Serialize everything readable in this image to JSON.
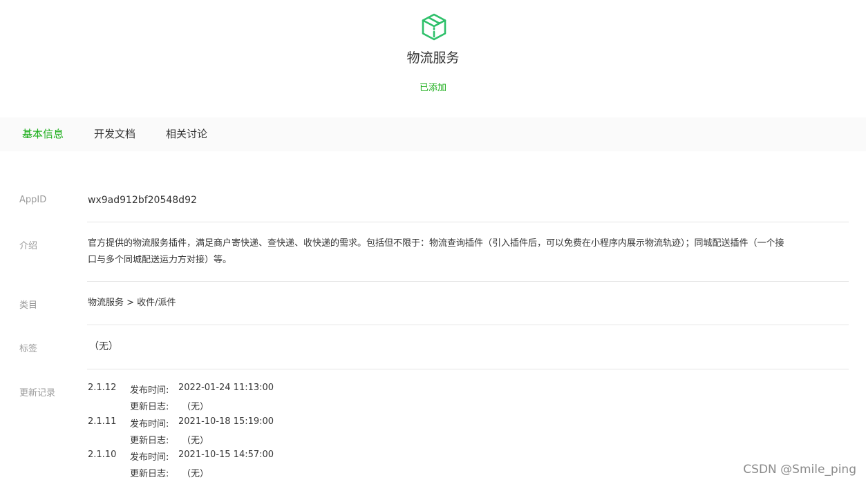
{
  "header": {
    "icon": "package-box-icon",
    "title": "物流服务",
    "status": "已添加",
    "accent_color": "#1aad19",
    "icon_color": "#2ec06a"
  },
  "tabs": [
    {
      "label": "基本信息",
      "active": true
    },
    {
      "label": "开发文档",
      "active": false
    },
    {
      "label": "相关讨论",
      "active": false
    }
  ],
  "info": {
    "appid": {
      "label": "AppID",
      "value": "wx9ad912bf20548d92"
    },
    "intro": {
      "label": "介绍",
      "line1": "官方提供的物流服务插件，满足商户寄快递、查快递、收快递的需求。包括但不限于：物流查询插件（引入插件后，可以免费在小程序内展示物流轨迹）；同城配送插件（一个接",
      "line2": "口与多个同城配送运力方对接）等。"
    },
    "category": {
      "label": "类目",
      "value": "物流服务 > 收件/派件"
    },
    "tags": {
      "label": "标签",
      "value": "（无）"
    },
    "changelog": {
      "label": "更新记录",
      "entries": [
        {
          "version": "2.1.12",
          "time_key": "发布时间:",
          "time": "2022-01-24 11:13:00",
          "log_key": "更新日志:",
          "log": "（无）"
        },
        {
          "version": "2.1.11",
          "time_key": "发布时间:",
          "time": "2021-10-18 15:19:00",
          "log_key": "更新日志:",
          "log": "（无）"
        },
        {
          "version": "2.1.10",
          "time_key": "发布时间:",
          "time": "2021-10-15 14:57:00",
          "log_key": "更新日志:",
          "log": "（无）"
        }
      ]
    }
  },
  "watermark": "CSDN @Smile_ping"
}
